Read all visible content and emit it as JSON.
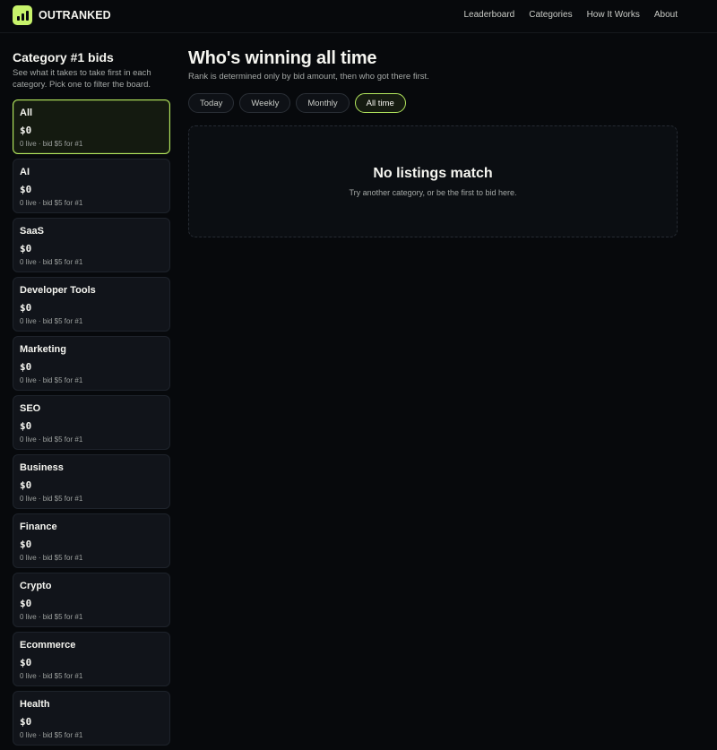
{
  "header": {
    "brand": "OUTRANKED",
    "nav": [
      "Leaderboard",
      "Categories",
      "How It Works",
      "About"
    ]
  },
  "sidebar": {
    "title": "Category #1 bids",
    "description": "See what it takes to take first in each category. Pick one to filter the board.",
    "cards": [
      {
        "name": "All",
        "amount": "$0",
        "meta": "0 live · bid $5 for #1"
      },
      {
        "name": "AI",
        "amount": "$0",
        "meta": "0 live · bid $5 for #1"
      },
      {
        "name": "SaaS",
        "amount": "$0",
        "meta": "0 live · bid $5 for #1"
      },
      {
        "name": "Developer Tools",
        "amount": "$0",
        "meta": "0 live · bid $5 for #1"
      },
      {
        "name": "Marketing",
        "amount": "$0",
        "meta": "0 live · bid $5 for #1"
      },
      {
        "name": "SEO",
        "amount": "$0",
        "meta": "0 live · bid $5 for #1"
      },
      {
        "name": "Business",
        "amount": "$0",
        "meta": "0 live · bid $5 for #1"
      },
      {
        "name": "Finance",
        "amount": "$0",
        "meta": "0 live · bid $5 for #1"
      },
      {
        "name": "Crypto",
        "amount": "$0",
        "meta": "0 live · bid $5 for #1"
      },
      {
        "name": "Ecommerce",
        "amount": "$0",
        "meta": "0 live · bid $5 for #1"
      },
      {
        "name": "Health",
        "amount": "$0",
        "meta": "0 live · bid $5 for #1"
      }
    ]
  },
  "main": {
    "title": "Who's winning all time",
    "subtitle": "Rank is determined only by bid amount, then who got there first.",
    "tabs": [
      "Today",
      "Weekly",
      "Monthly",
      "All time"
    ],
    "empty_title": "No listings match",
    "empty_desc": "Try another category, or be the first to bid here."
  },
  "colors": {
    "accent": "#c7f36b",
    "background": "#07090c",
    "card": "#11141a"
  },
  "icons": {
    "brand_logo": "bar-chart-icon"
  }
}
